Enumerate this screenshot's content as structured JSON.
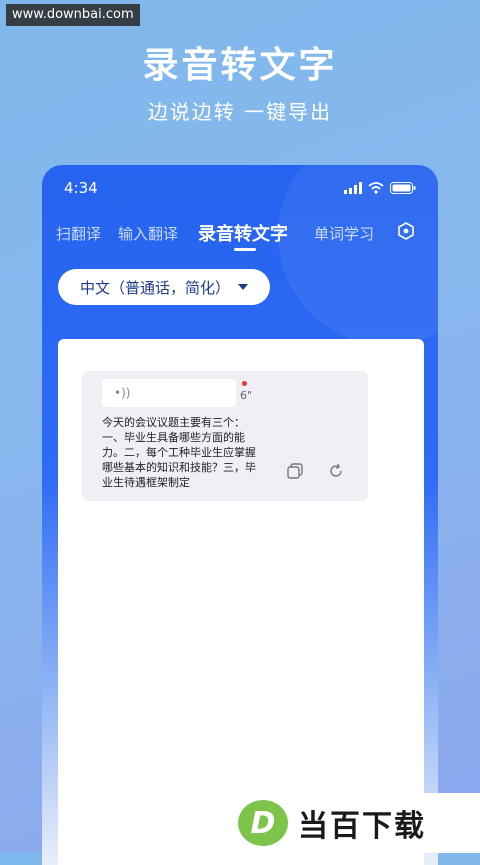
{
  "watermark": "www.downbai.com",
  "hero": {
    "title": "录音转文字",
    "subtitle": "边说边转 一键导出"
  },
  "status_bar": {
    "time": "4:34"
  },
  "tabs": [
    {
      "label": "扫翻译"
    },
    {
      "label": "输入翻译"
    },
    {
      "label": "录音转文字",
      "active": true
    },
    {
      "label": "单词学习"
    }
  ],
  "language_selector": {
    "value": "中文（普通话，简化）"
  },
  "record": {
    "audio_indicator": "•))",
    "duration": "6\"",
    "transcript": "今天的会议议题主要有三个：一、毕业生具备哪些方面的能力。二，每个工种毕业生应掌握哪些基本的知识和技能？三，毕业生待遇框架制定"
  },
  "footer": {
    "logo_letter": "D",
    "brand_name": "当百下载"
  },
  "colors": {
    "accent": "#2563f0",
    "brand_green": "#7dc44a"
  },
  "icons": [
    "signal-icon",
    "wifi-icon",
    "battery-icon",
    "settings-icon",
    "copy-icon",
    "refresh-icon"
  ]
}
